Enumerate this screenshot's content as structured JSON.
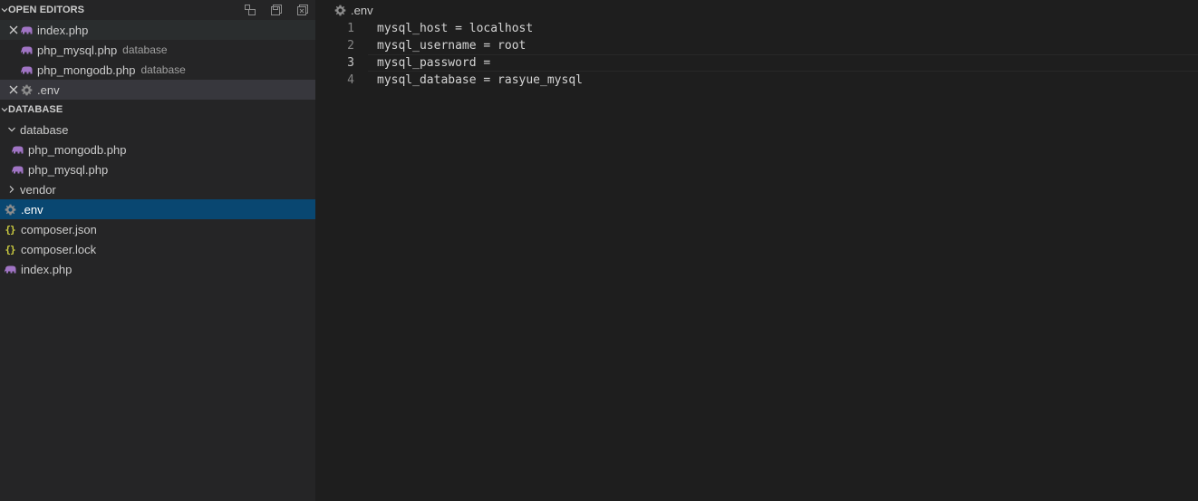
{
  "colors": {
    "sidebar_bg": "#252526",
    "editor_bg": "#1e1e1e",
    "selected_row": "#094771",
    "php_icon": "#a074c4",
    "json_icon": "#cbcb41",
    "gear_icon": "#8c8c8c"
  },
  "open_editors": {
    "title": "OPEN EDITORS",
    "items": [
      {
        "name": "index.php",
        "desc": "",
        "icon": "php-elephant-icon",
        "close": "✕"
      },
      {
        "name": "php_mysql.php",
        "desc": "database",
        "icon": "php-elephant-icon"
      },
      {
        "name": "php_mongodb.php",
        "desc": "database",
        "icon": "php-elephant-icon"
      },
      {
        "name": ".env",
        "desc": "",
        "icon": "gear-icon",
        "close": "✕"
      }
    ]
  },
  "explorer": {
    "title": "DATABASE",
    "items": [
      {
        "name": "database",
        "type": "folder",
        "expanded": true
      },
      {
        "name": "php_mongodb.php",
        "type": "file",
        "icon": "php-elephant-icon"
      },
      {
        "name": "php_mysql.php",
        "type": "file",
        "icon": "php-elephant-icon"
      },
      {
        "name": "vendor",
        "type": "folder",
        "expanded": false
      },
      {
        "name": ".env",
        "type": "file",
        "icon": "gear-icon",
        "selected": true
      },
      {
        "name": "composer.json",
        "type": "file",
        "icon": "json-braces-icon",
        "glyph": "{}"
      },
      {
        "name": "composer.lock",
        "type": "file",
        "icon": "json-braces-icon",
        "glyph": "{}"
      },
      {
        "name": "index.php",
        "type": "file",
        "icon": "php-elephant-icon"
      }
    ]
  },
  "editor": {
    "file_title": ".env",
    "lines": [
      {
        "num": "1",
        "text": "mysql_host = localhost"
      },
      {
        "num": "2",
        "text": "mysql_username = root"
      },
      {
        "num": "3",
        "text": "mysql_password = "
      },
      {
        "num": "4",
        "text": "mysql_database = rasyue_mysql"
      }
    ],
    "current_line": 3
  }
}
